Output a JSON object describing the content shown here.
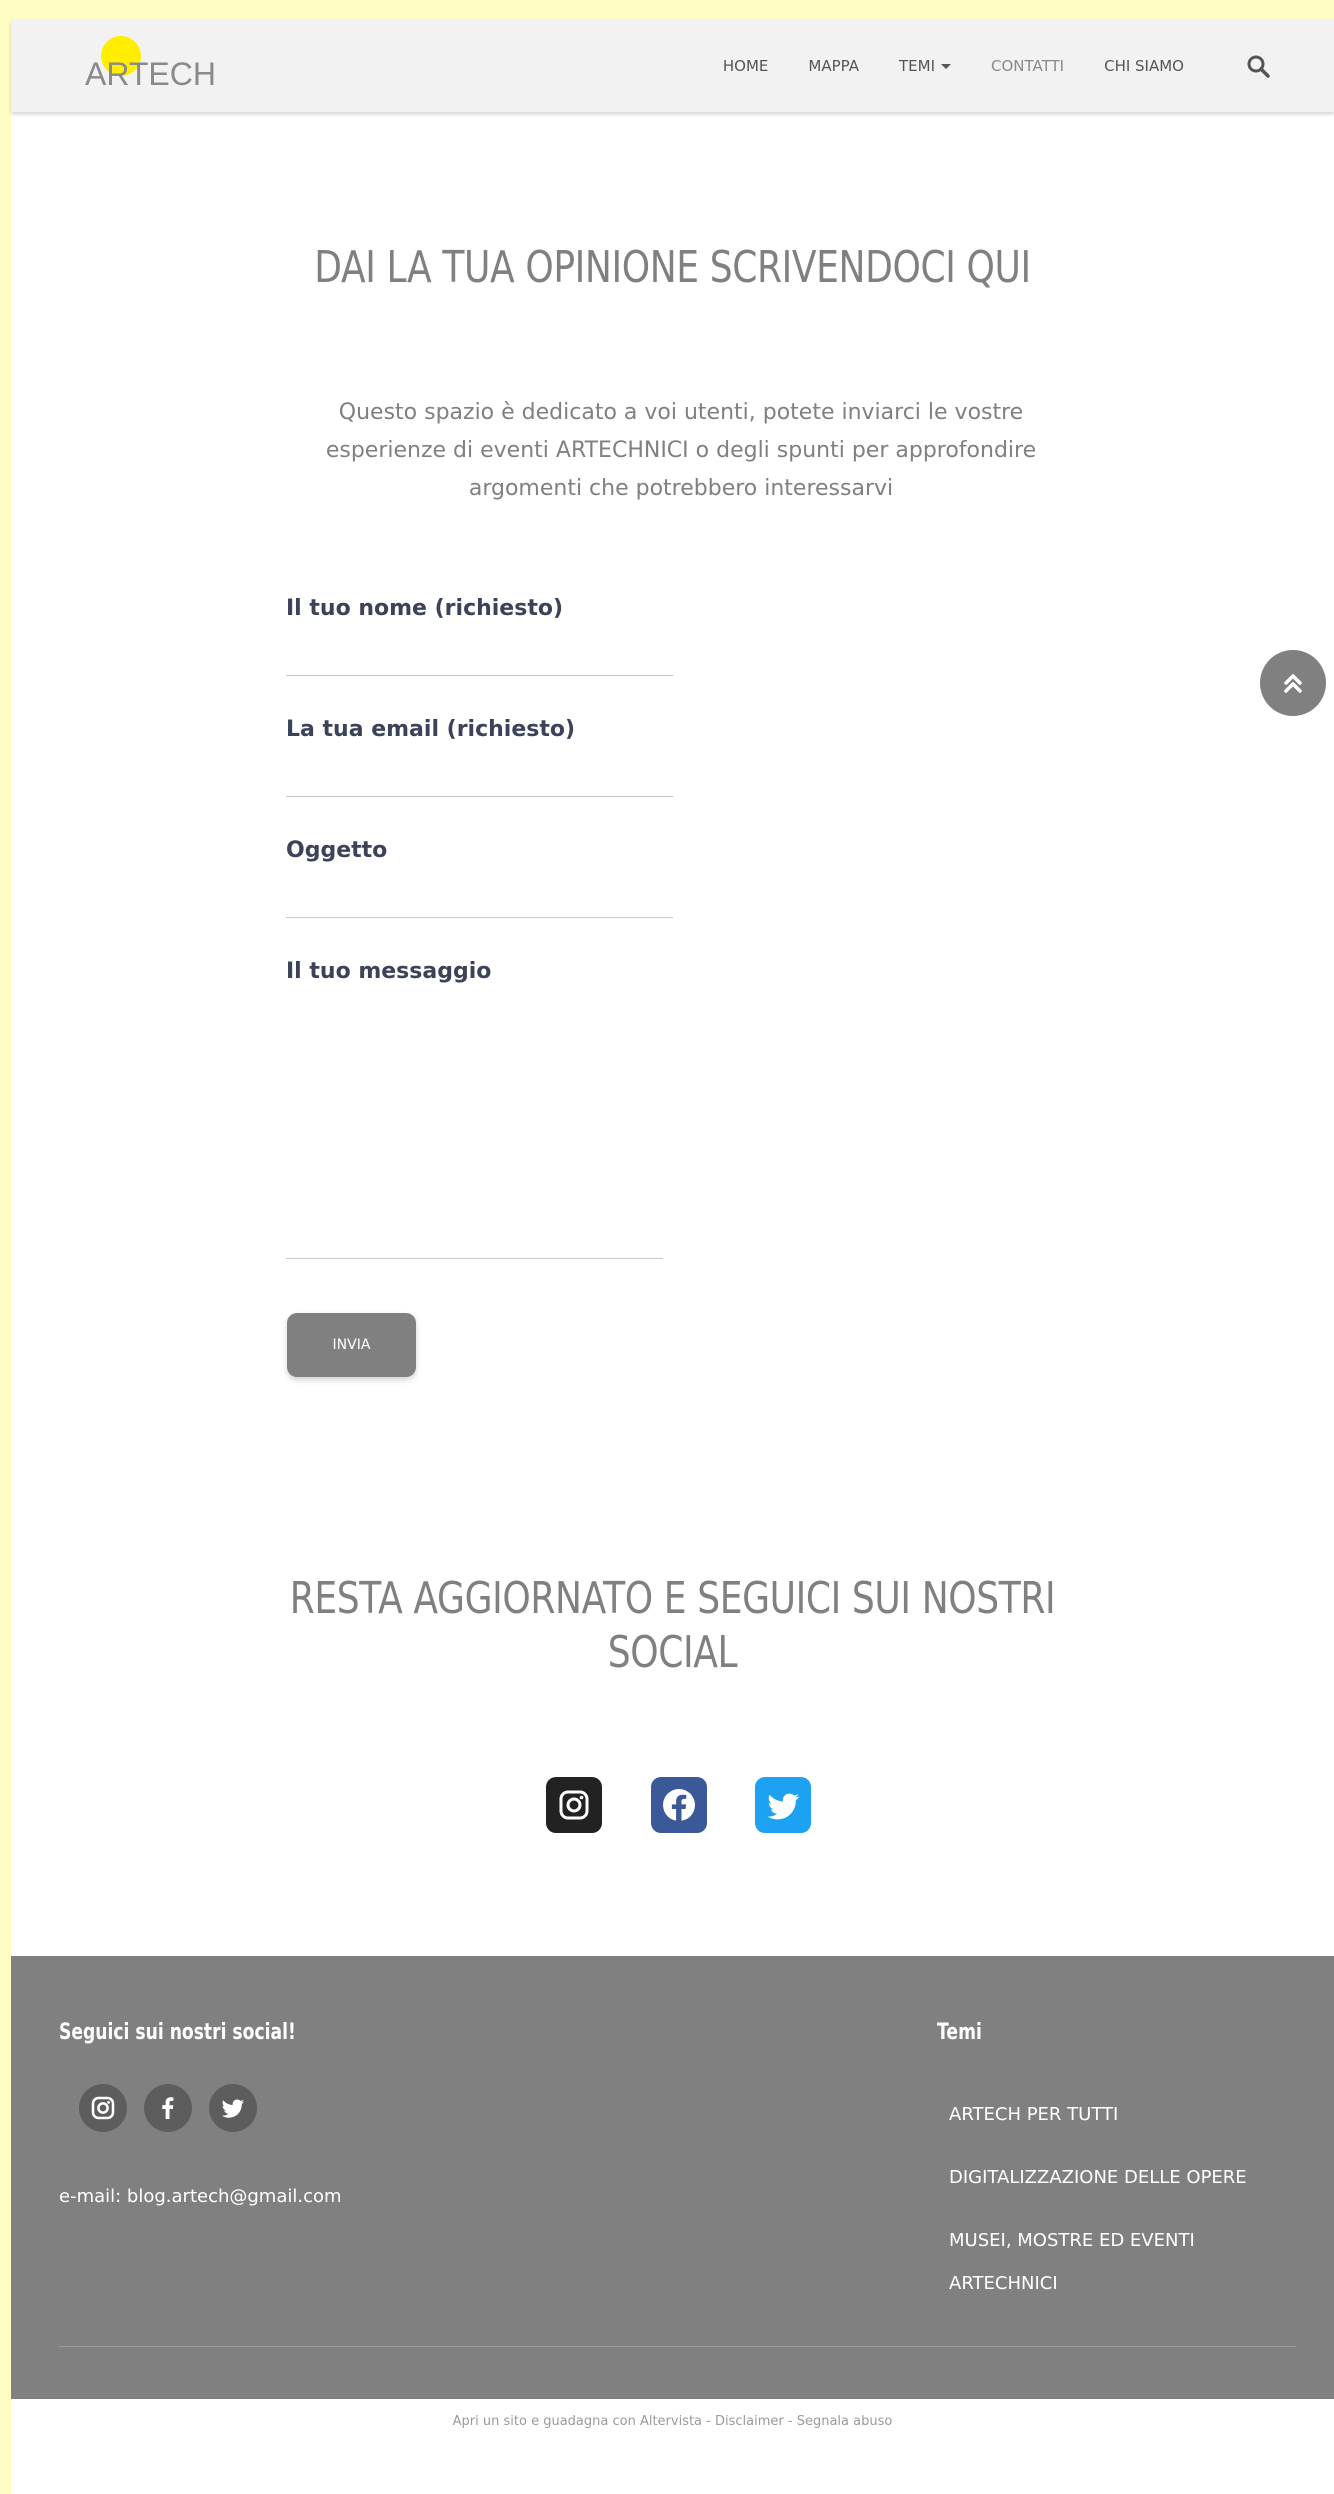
{
  "brand": {
    "logo_text": "ARTECH"
  },
  "nav": {
    "items": [
      {
        "label": "HOME"
      },
      {
        "label": "MAPPA"
      },
      {
        "label": "TEMI"
      },
      {
        "label": "CONTATTI"
      },
      {
        "label": "CHI SIAMO"
      }
    ]
  },
  "main": {
    "title": "DAI LA TUA OPINIONE SCRIVENDOCI QUI",
    "intro": "Questo spazio è dedicato a voi utenti, potete inviarci le vostre esperienze di eventi ARTECHNICI o degli spunti per approfondire argomenti che potrebbero interessarvi"
  },
  "form": {
    "name_label": "Il tuo nome (richiesto)",
    "email_label": "La tua email (richiesto)",
    "subject_label": "Oggetto",
    "message_label": "Il tuo messaggio",
    "submit_label": "INVIA"
  },
  "social_section": {
    "title_line1": "RESTA AGGIORNATO E SEGUICI SUI NOSTRI",
    "title_line2": "SOCIAL"
  },
  "footer": {
    "social_title": "Seguici sui nostri social!",
    "email": "e-mail: blog.artech@gmail.com",
    "temi_title": "Temi",
    "temi_links": [
      {
        "label": "ARTECH PER TUTTI"
      },
      {
        "label": "DIGITALIZZAZIONE DELLE OPERE"
      },
      {
        "label": "MUSEI, MOSTRE ED EVENTI"
      },
      {
        "label": "ARTECHNICI"
      }
    ]
  },
  "bottom_bar": {
    "link1": "Apri un sito e guadagna con Altervista",
    "sep": " - ",
    "link2": "Disclaimer",
    "link3": "Segnala abuso"
  },
  "colors": {
    "page_border": "#fffdc4",
    "footer_bg": "#808080",
    "accent_gray": "#808080",
    "instagram": "#222222",
    "facebook": "#3b5998",
    "twitter": "#1da1f2"
  },
  "icons": [
    "search-icon",
    "chevron-up-icon",
    "instagram-icon",
    "facebook-icon",
    "twitter-icon"
  ]
}
